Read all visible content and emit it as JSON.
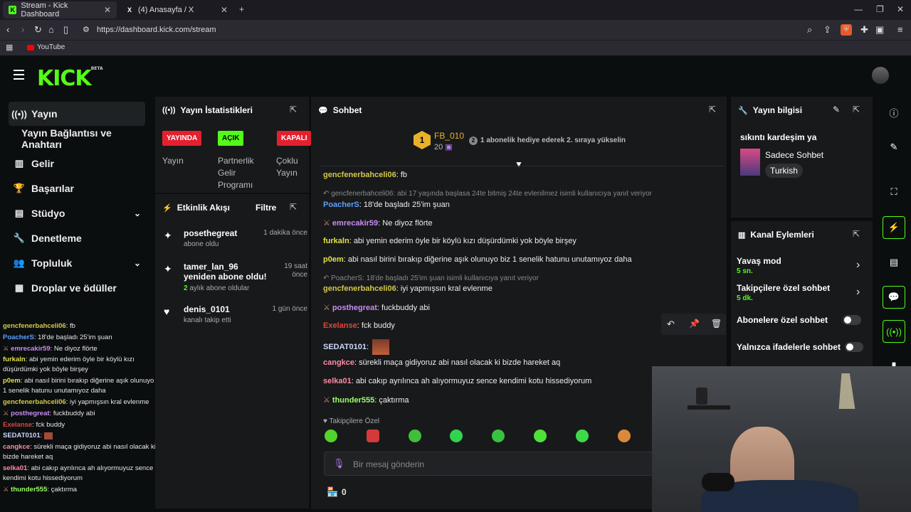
{
  "browser": {
    "tabs": [
      {
        "title": "Stream - Kick Dashboard",
        "favicon": "kick-icon"
      },
      {
        "title": "(4) Anasayfa / X",
        "favicon": "x-icon"
      }
    ],
    "url": "https://dashboard.kick.com/stream",
    "bookmarks": [
      {
        "label": "YouTube"
      }
    ]
  },
  "header": {
    "logo": "KICK",
    "logo_tag": "BETA"
  },
  "sidebar": {
    "items": [
      {
        "label": "Yayın",
        "icon": "broadcast-icon"
      },
      {
        "label": "Yayın Bağlantısı ve Anahtarı",
        "icon": ""
      },
      {
        "label": "Gelir",
        "icon": "chart-icon"
      },
      {
        "label": "Başarılar",
        "icon": "trophy-icon"
      },
      {
        "label": "Stüdyo",
        "icon": "studio-icon"
      },
      {
        "label": "Denetleme",
        "icon": "wrench-icon"
      },
      {
        "label": "Topluluk",
        "icon": "people-icon"
      },
      {
        "label": "Droplar ve ödüller",
        "icon": "gift-icon"
      }
    ]
  },
  "mini_chat": [
    {
      "user": "gencfenerbahceli06",
      "color": "#d4c84a",
      "text": "fb"
    },
    {
      "user": "PoacherS",
      "color": "#5aa0ff",
      "text": "18'de başladı 25'im şuan"
    },
    {
      "user": "emrecakir59",
      "color": "#c98cf2",
      "text": "Ne diyoz flörte",
      "mod": true
    },
    {
      "user": "furkaln",
      "color": "#e0e04a",
      "text": "abi yemin ederim öyle bir köylü kızı düşürdümki yok böyle birşey"
    },
    {
      "user": "p0em",
      "color": "#e0e04a",
      "text": "abi nasıl birini bırakıp diğerine aşık olunuyo biz 1 senelik hatunu unutamıyoz daha"
    },
    {
      "user": "gencfenerbahceli06",
      "color": "#d4c84a",
      "text": "iyi yapmışsın kral evlenme"
    },
    {
      "user": "posthegreat",
      "color": "#c98cf2",
      "text": "fuckbuddy abi",
      "mod": true
    },
    {
      "user": "Exelanse",
      "color": "#e0453a",
      "text": "fck buddy"
    },
    {
      "user": "SEDAT0101",
      "color": "#cfd7ff",
      "text": ""
    },
    {
      "user": "cangkce",
      "color": "#ff8aa8",
      "text": "sürekli maça gidiyoruz abi nasıl olacak ki bizde hareket aq"
    },
    {
      "user": "selka01",
      "color": "#ff8aa8",
      "text": "abi cakıp ayrılınca ah alıyormuyuz sence kendimi kotu hissediyorum"
    },
    {
      "user": "thunder555",
      "color": "#9dff6a",
      "text": "çaktırma",
      "mod": true
    }
  ],
  "stats_panel": {
    "title": "Yayın İstatistikleri",
    "badges": [
      {
        "label": "YAYINDA",
        "color": "#e4202f"
      },
      {
        "label": "AÇIK",
        "color": "#53fc18"
      },
      {
        "label": "KAPALI",
        "color": "#e4202f"
      }
    ],
    "labels": [
      "Yayın",
      "Partnerlik Gelir Programı",
      "Çoklu Yayın"
    ]
  },
  "activity_panel": {
    "title": "Etkinlik Akışı",
    "filter": "Filtre",
    "items": [
      {
        "icon": "sparkle-icon",
        "title": "posethegreat",
        "sub": "abone oldu",
        "time": "1 dakika önce"
      },
      {
        "icon": "sparkle-icon",
        "title": "tamer_lan_96 yeniden abone oldu!",
        "sub_highlight": "2",
        "sub": "aylık abone oldular",
        "time": "19 saat önce"
      },
      {
        "icon": "heart-icon",
        "title": "denis_0101",
        "sub": "kanalı takip etti",
        "time": "1 gün önce"
      }
    ]
  },
  "chat_panel": {
    "title": "Sohbet",
    "leader": {
      "name": "FB_010",
      "rank": "1",
      "count": "20"
    },
    "gift_text": "1 abonelik hediye ederek 2. sıraya yükselin",
    "gift_rank": "2",
    "messages": [
      {
        "user": "gencfenerbahceli06",
        "color": "#d4c84a",
        "text": "fb"
      },
      {
        "reply": "gencfenerbahceli06: abi 17 yaşında başlasa 24te bitmiş 24te evlenilmez isimli kullanıcıya yanıt veriyor"
      },
      {
        "user": "PoacherS",
        "color": "#5aa0ff",
        "text": "18'de başladı 25'im şuan"
      },
      {
        "user": "emrecakir59",
        "color": "#c98cf2",
        "text": "Ne diyoz flörte",
        "mod": true
      },
      {
        "user": "furkaln",
        "color": "#e0e04a",
        "text": "abi yemin ederim öyle bir köylü kızı düşürdümki yok böyle birşey"
      },
      {
        "user": "p0em",
        "color": "#e0e04a",
        "text": "abi nasıl birini bırakıp diğerine aşık olunuyo biz 1 senelik hatunu unutamıyoz daha"
      },
      {
        "reply": "PoacherS: 18'de başladı 25'im şuan isimli kullanıcıya yanıt veriyor"
      },
      {
        "user": "gencfenerbahceli06",
        "color": "#d4c84a",
        "text": "iyi yapmışsın kral evlenme"
      },
      {
        "user": "posthegreat",
        "color": "#c98cf2",
        "text": "fuckbuddy abi",
        "mod": true
      },
      {
        "user": "Exelanse",
        "color": "#e0453a",
        "text": "fck buddy"
      },
      {
        "user": "SEDAT0101",
        "color": "#cfd7ff",
        "text": ""
      },
      {
        "user": "cangkce",
        "color": "#ff8aa8",
        "text": "sürekli maça gidiyoruz abi nasıl olacak ki bizde hareket aq"
      },
      {
        "user": "selka01",
        "color": "#ff8aa8",
        "text": "abi cakıp ayrılınca ah alıyormuyuz sence kendimi kotu hissediyorum"
      },
      {
        "user": "thunder555",
        "color": "#9dff6a",
        "text": "çaktırma",
        "mod": true
      }
    ],
    "followers_only": "Takipçilere Özel",
    "input_placeholder": "Bir mesaj gönderin",
    "points": "0"
  },
  "info_panel": {
    "title": "Yayın bilgisi",
    "stream_title": "sıkıntı kardeşim ya",
    "category": "Sadece Sohbet",
    "tag": "Turkish"
  },
  "channel_actions": {
    "title": "Kanal Eylemleri",
    "items": [
      {
        "label": "Yavaş mod",
        "sub": "5 sn.",
        "control": "chevron"
      },
      {
        "label": "Takipçilere özel sohbet",
        "sub": "5 dk.",
        "control": "chevron"
      },
      {
        "label": "Abonelere özel sohbet",
        "control": "toggle"
      },
      {
        "label": "Yalnızca ifadelerle sohbet",
        "control": "toggle"
      }
    ]
  },
  "colors": {
    "accent": "#53fc18",
    "live": "#e4202f",
    "panel": "#18191b"
  }
}
